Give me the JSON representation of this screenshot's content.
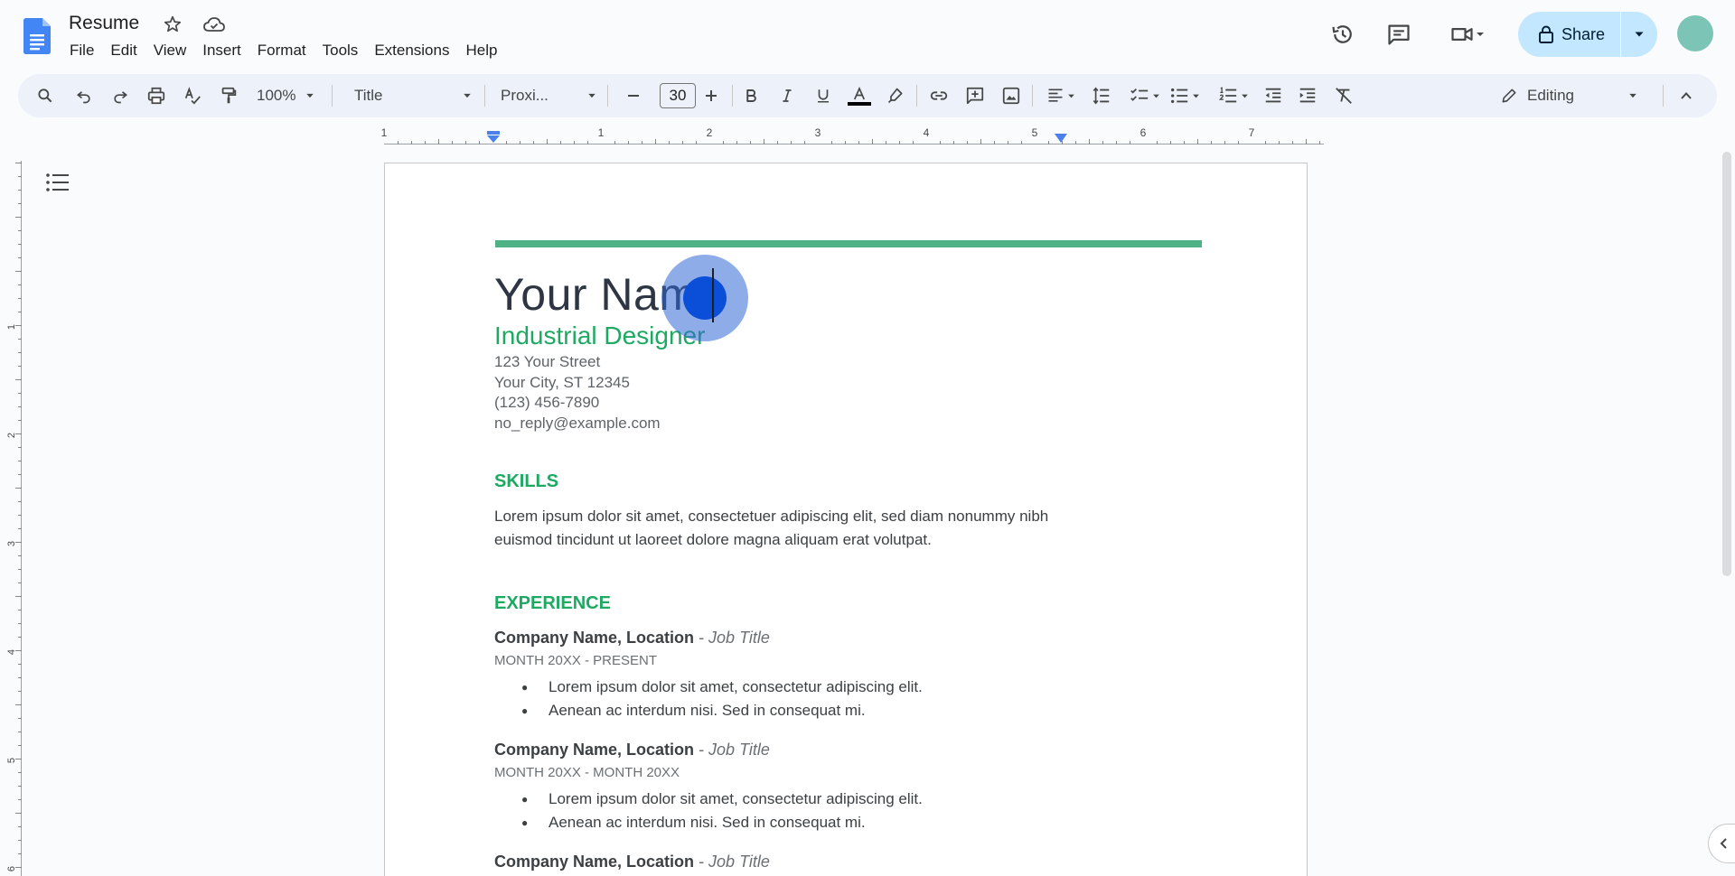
{
  "header": {
    "doc_title": "Resume",
    "menu": [
      "File",
      "Edit",
      "View",
      "Insert",
      "Format",
      "Tools",
      "Extensions",
      "Help"
    ],
    "share_label": "Share"
  },
  "toolbar": {
    "zoom": "100%",
    "style": "Title",
    "font": "Proxi...",
    "font_size": "30",
    "mode": "Editing"
  },
  "ruler": {
    "h_numbers": [
      "1",
      "1",
      "2",
      "3",
      "4",
      "5",
      "6",
      "7"
    ],
    "v_numbers": [
      "1",
      "2",
      "3",
      "4",
      "5",
      "6"
    ]
  },
  "document": {
    "name": "Your Name",
    "title": "Industrial Designer",
    "address": [
      "123 Your Street",
      "Your City, ST 12345",
      "(123) 456-7890",
      "no_reply@example.com"
    ],
    "skills_heading": "SKILLS",
    "skills_text": "Lorem ipsum dolor sit amet, consectetuer adipiscing elit, sed diam nonummy nibh euismod tincidunt ut laoreet dolore magna aliquam erat volutpat.",
    "experience_heading": "EXPERIENCE",
    "jobs": [
      {
        "company": "Company Name,  Location",
        "job_title": " - Job Title",
        "dates": "MONTH 20XX - PRESENT",
        "bullets": [
          "Lorem ipsum dolor sit amet, consectetur adipiscing elit.",
          "Aenean ac interdum nisi. Sed in consequat mi."
        ]
      },
      {
        "company": "Company Name, Location",
        "job_title": " - Job Title",
        "dates": "MONTH 20XX - MONTH 20XX",
        "bullets": [
          "Lorem ipsum dolor sit amet, consectetur adipiscing elit.",
          "Aenean ac interdum nisi. Sed in consequat mi."
        ]
      },
      {
        "company": "Company Name, Location",
        "job_title": " - Job Title"
      }
    ]
  },
  "colors": {
    "accent_green": "#1ea962",
    "accent_bar": "#4fb287",
    "share_bg": "#c2e7ff",
    "toolbar_bg": "#edf2fa",
    "click_indicator": "#0b4fd8"
  },
  "icons": [
    "docs-logo-icon",
    "star-icon",
    "cloud-saved-icon",
    "history-icon",
    "comments-icon",
    "meet-icon",
    "lock-icon",
    "search-icon",
    "undo-icon",
    "redo-icon",
    "print-icon",
    "spellcheck-icon",
    "paint-format-icon",
    "bold-icon",
    "italic-icon",
    "underline-icon",
    "text-color-icon",
    "highlight-icon",
    "link-icon",
    "add-comment-icon",
    "image-icon",
    "align-left-icon",
    "line-spacing-icon",
    "checklist-icon",
    "bulleted-list-icon",
    "numbered-list-icon",
    "decrease-indent-icon",
    "increase-indent-icon",
    "clear-formatting-icon",
    "pencil-icon",
    "chevron-up-icon",
    "outline-icon"
  ]
}
